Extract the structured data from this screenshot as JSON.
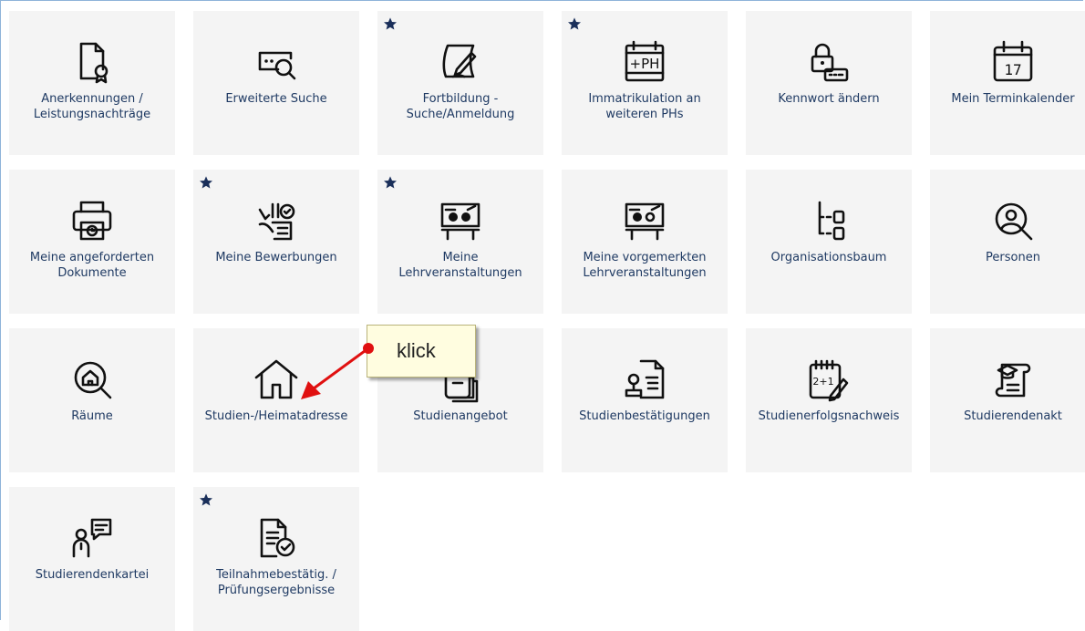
{
  "tiles": [
    {
      "label": "Anerkennungen /\nLeistungsnachträge",
      "icon": "certificate-icon",
      "starred": false
    },
    {
      "label": "Erweiterte Suche",
      "icon": "advanced-search-icon",
      "starred": false
    },
    {
      "label": "Fortbildung -\nSuche/Anmeldung",
      "icon": "pen-paper-icon",
      "starred": true
    },
    {
      "label": "Immatrikulation an\nweiteren PHs",
      "icon": "ph-calendar-icon",
      "starred": true
    },
    {
      "label": "Kennwort ändern",
      "icon": "lock-password-icon",
      "starred": false
    },
    {
      "label": "Mein Terminkalender",
      "icon": "calendar-17-icon",
      "starred": false
    },
    {
      "label": "Meine angeforderten\nDokumente",
      "icon": "printer-icon",
      "starred": false
    },
    {
      "label": "Meine Bewerbungen",
      "icon": "application-hand-icon",
      "starred": true
    },
    {
      "label": "Meine\nLehrveranstaltungen",
      "icon": "lecture-board-icon",
      "starred": true
    },
    {
      "label": "Meine vorgemerkten\nLehrveranstaltungen",
      "icon": "lecture-board-marked-icon",
      "starred": false
    },
    {
      "label": "Organisationsbaum",
      "icon": "org-tree-icon",
      "starred": false
    },
    {
      "label": "Personen",
      "icon": "person-search-icon",
      "starred": false
    },
    {
      "label": "Räume",
      "icon": "room-search-icon",
      "starred": false
    },
    {
      "label": "Studien-/Heimatadresse",
      "icon": "house-icon",
      "starred": false
    },
    {
      "label": "Studienangebot",
      "icon": "study-offer-icon",
      "starred": false
    },
    {
      "label": "Studienbestätigungen",
      "icon": "confirmation-stamp-icon",
      "starred": false
    },
    {
      "label": "Studienerfolgsnachweis",
      "icon": "notepad-math-icon",
      "starred": false
    },
    {
      "label": "Studierendenakt",
      "icon": "graduation-scroll-icon",
      "starred": false
    },
    {
      "label": "Studierendenkartei",
      "icon": "person-speech-icon",
      "starred": false
    },
    {
      "label": "Teilnahmebestätig. /\nPrüfungsergebnisse",
      "icon": "document-check-icon",
      "starred": true
    }
  ],
  "callout": {
    "text": "klick"
  },
  "colors": {
    "tile_bg": "#f4f4f4",
    "label": "#1f3a63",
    "star": "#1a2f5a",
    "arrow": "#e01010"
  }
}
